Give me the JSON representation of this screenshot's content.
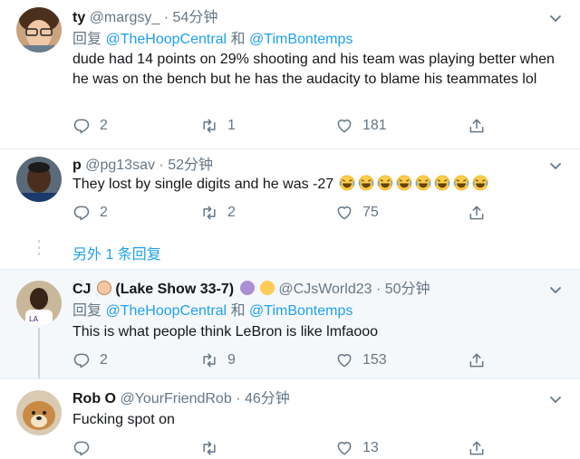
{
  "tweets": [
    {
      "name": "ty",
      "handle": "@margsy_",
      "time": "54分钟",
      "reply_prefix": "回复",
      "reply_to": [
        "@TheHoopCentral",
        "@TimBontemps"
      ],
      "reply_and": "和",
      "text": "dude had 14 points on 29% shooting and his team was playing better when he was on the bench but he has the audacity to blame his teammates lol",
      "replies": "2",
      "retweets": "1",
      "likes": "181"
    },
    {
      "name": "p",
      "handle": "@pg13sav",
      "time": "52分钟",
      "text": "They lost by single digits and he was -27",
      "emoji_count": 8,
      "replies": "2",
      "retweets": "2",
      "likes": "75"
    },
    {
      "name": "CJ",
      "name_suffix": "(Lake Show 33-7)",
      "handle": "@CJsWorld23",
      "time": "50分钟",
      "reply_prefix": "回复",
      "reply_to": [
        "@TheHoopCentral",
        "@TimBontemps"
      ],
      "reply_and": "和",
      "text": "This is what people think LeBron is like lmfaooo",
      "replies": "2",
      "retweets": "9",
      "likes": "153"
    },
    {
      "name": "Rob O",
      "handle": "@YourFriendRob",
      "time": "46分钟",
      "text": "Fucking spot on",
      "replies": "",
      "retweets": "",
      "likes": "13"
    }
  ],
  "more_replies": "另外 1 条回复",
  "dot_separator": "·",
  "colors": {
    "link": "#1da1f2",
    "muted": "#657786",
    "highlight_bg": "#f5f8fa"
  },
  "icons": [
    "reply-icon",
    "retweet-icon",
    "like-icon",
    "share-icon",
    "chevron-down-icon"
  ]
}
